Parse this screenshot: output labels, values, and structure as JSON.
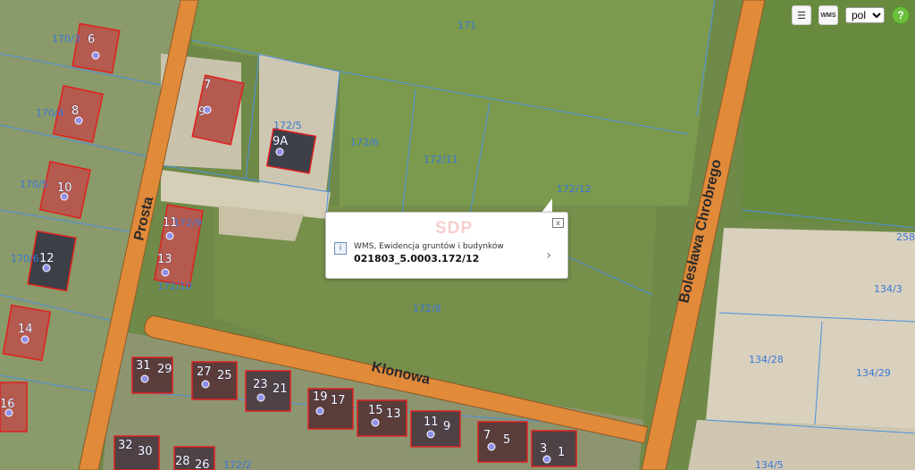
{
  "toolbar": {
    "list_icon": "list-icon",
    "wms_label": "WMS",
    "language": "pol",
    "help_label": "?"
  },
  "roads": {
    "prosta": "Prosta",
    "klonowa": "Klonowa",
    "chrobrego": "Bolesława Chrobrego"
  },
  "parcels": [
    "171",
    "170/3",
    "170/4",
    "170/5",
    "170/6",
    "172/5",
    "172/6",
    "172/11",
    "172/12",
    "172/9",
    "172/10",
    "172/8",
    "258",
    "134/3",
    "134/28",
    "134/29",
    "134/5",
    "172/2"
  ],
  "houses": [
    "6",
    "7",
    "8",
    "9",
    "9A",
    "10",
    "11",
    "12",
    "13",
    "14",
    "16",
    "31",
    "29",
    "27",
    "25",
    "23",
    "21",
    "19",
    "17",
    "15",
    "13",
    "11",
    "9",
    "7",
    "5",
    "3",
    "1",
    "32",
    "30",
    "28",
    "26"
  ],
  "popup": {
    "watermark": "SDP",
    "layer": "WMS, Ewidencja gruntów i budynków",
    "parcel_id": "021803_5.0003.172/12",
    "info_icon": "i",
    "close_icon": "x",
    "chevron_icon": "›"
  },
  "colors": {
    "road": "#e08a3a",
    "parcel_line": "#4d8fe0",
    "building_outline": "#e02020",
    "field": "#6f8a48"
  }
}
